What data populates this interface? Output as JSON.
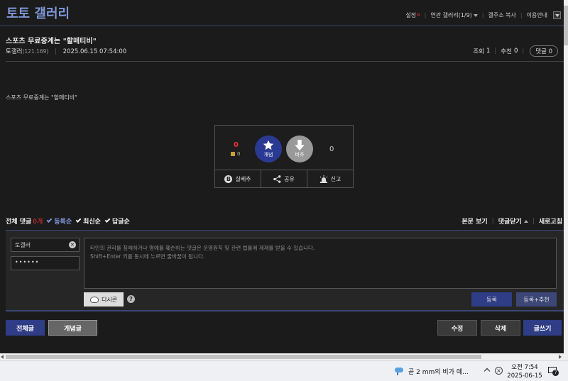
{
  "gallery": {
    "title": "토토 갤러리"
  },
  "top_links": {
    "settings": "설정",
    "new_badge": "N",
    "related": "연관 갤러리(1/9)",
    "copy_url": "갤주소 복사",
    "guide": "이용안내"
  },
  "post": {
    "title": "스포츠 무료중계는 \"할매티비\"",
    "author": "토갤러",
    "ip": "(121.169)",
    "date": "2025.06.15 07:54:00",
    "views_label": "조회",
    "views": "1",
    "recommend_label": "추천",
    "recommend": "0",
    "comments_label": "댓글",
    "comments": "0",
    "body": "스포츠 무료중계는 \"할매티비\""
  },
  "vote": {
    "up_count": "0",
    "fix_count": "0",
    "up_label": "개념",
    "down_label": "비추",
    "down_count": "0",
    "best_label": "실베추",
    "share_label": "공유",
    "report_label": "신고"
  },
  "comments": {
    "total_label": "전체 댓글",
    "total_count": "0개",
    "sort_registered": "등록순",
    "sort_latest": "최신순",
    "sort_reply": "답글순",
    "view_post": "본문 보기",
    "close_comments": "댓글닫기",
    "refresh": "새로고침",
    "nickname": "토갤러",
    "password_mask": "••••••",
    "placeholder_line1": "타인의 권리를 침해하거나 명예를 훼손하는 댓글은 운영원칙 및 관련 법률에 제재를 받을 수 있습니다.",
    "placeholder_line2": "Shift+Enter 키를 동시에 누르면 줄바꿈이 됩니다.",
    "dccon_label": "디시콘",
    "submit_label": "등록",
    "submit_recommend_label": "등록+추천"
  },
  "bottom": {
    "all_posts": "전체글",
    "concept_posts": "개념글",
    "edit": "수정",
    "delete": "삭제",
    "write": "글쓰기"
  },
  "taskbar": {
    "weather": "곧 2 mm의 비가 예...",
    "time": "오전 7:54",
    "date": "2025-06-15",
    "notification_count": "7"
  }
}
